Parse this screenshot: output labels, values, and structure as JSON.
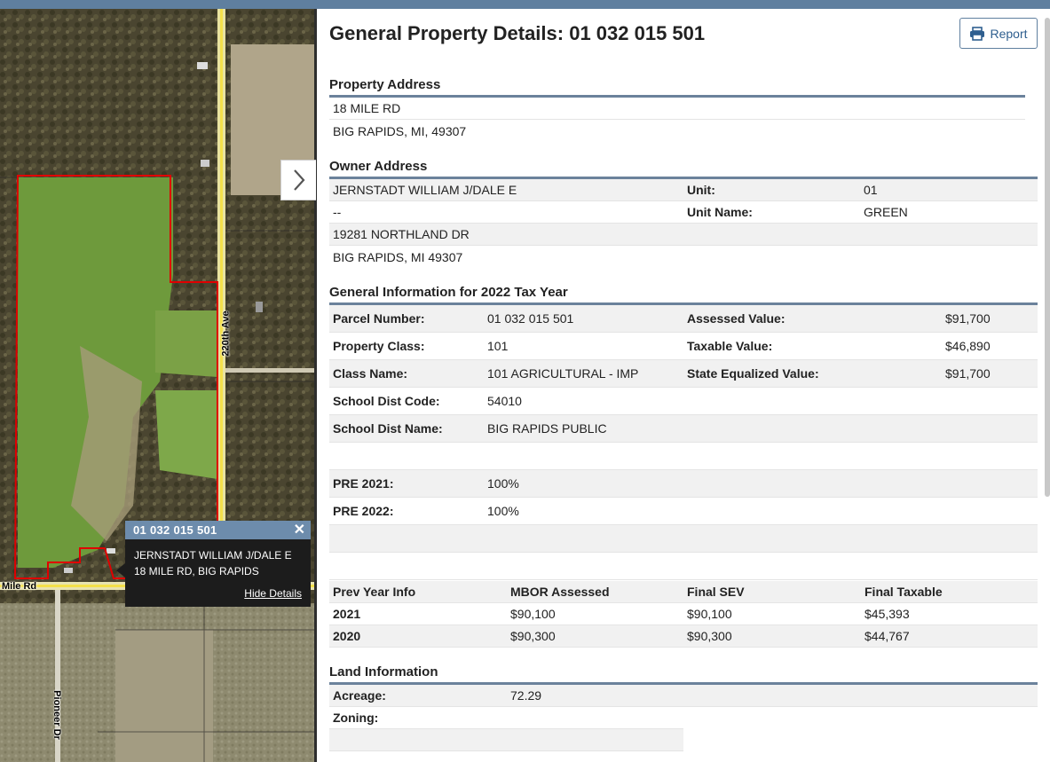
{
  "map": {
    "labels": {
      "road_220": "220th Ave",
      "mile_rd": "Mile Rd",
      "pioneer": "Pioneer Dr"
    },
    "popup": {
      "title": "01 032 015 501",
      "line1": "JERNSTADT WILLIAM J/DALE E",
      "line2": "18 MILE RD, BIG RAPIDS",
      "hide_link": "Hide Details"
    },
    "expand_icon": "chevron-right-icon"
  },
  "header": {
    "title": "General Property Details: 01 032 015 501",
    "report_label": "Report",
    "report_icon": "printer-icon"
  },
  "property_address": {
    "title": "Property Address",
    "lines": [
      "18 MILE RD",
      "BIG RAPIDS, MI, 49307"
    ]
  },
  "owner_address": {
    "title": "Owner Address",
    "lines": [
      "JERNSTADT WILLIAM J/DALE E",
      "--",
      "19281 NORTHLAND DR",
      "BIG RAPIDS, MI 49307"
    ],
    "unit_label": "Unit:",
    "unit_value": "01",
    "unit_name_label": "Unit Name:",
    "unit_name_value": "GREEN"
  },
  "general_info": {
    "title": "General Information for 2022 Tax Year",
    "rows": [
      {
        "label": "Parcel Number:",
        "value": "01 032 015 501",
        "label2": "Assessed Value:",
        "value2": "$91,700"
      },
      {
        "label": "Property Class:",
        "value": "101",
        "label2": "Taxable Value:",
        "value2": "$46,890"
      },
      {
        "label": "Class Name:",
        "value": "101 AGRICULTURAL - IMP",
        "label2": "State Equalized Value:",
        "value2": "$91,700"
      },
      {
        "label": "School Dist Code:",
        "value": "54010"
      },
      {
        "label": "School Dist Name:",
        "value": "BIG RAPIDS PUBLIC"
      }
    ],
    "pre_rows": [
      {
        "label": "PRE 2021:",
        "value": "100%"
      },
      {
        "label": "PRE 2022:",
        "value": "100%"
      }
    ]
  },
  "prev_year": {
    "headers": [
      "Prev Year Info",
      "MBOR Assessed",
      "Final SEV",
      "Final Taxable"
    ],
    "rows": [
      [
        "2021",
        "$90,100",
        "$90,100",
        "$45,393"
      ],
      [
        "2020",
        "$90,300",
        "$90,300",
        "$44,767"
      ]
    ]
  },
  "land_info": {
    "title": "Land Information",
    "acreage_label": "Acreage:",
    "acreage_value": "72.29",
    "zoning_label": "Zoning:",
    "zoning_value": ""
  },
  "colors": {
    "accent": "#5f7f9f",
    "parcel_outline": "#e00000",
    "popup_header": "#6d8cac"
  }
}
